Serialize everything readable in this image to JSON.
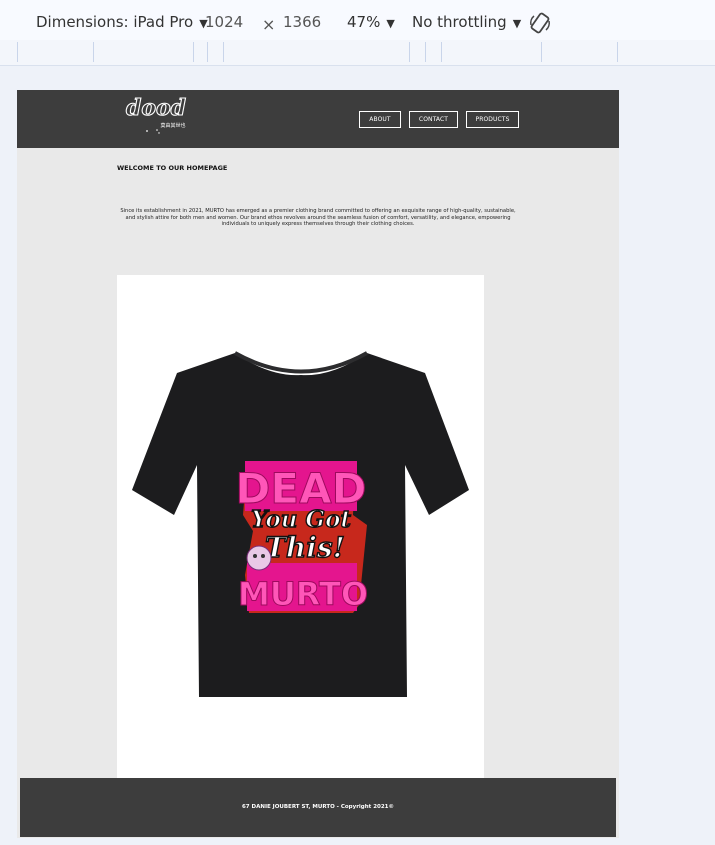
{
  "devtools": {
    "dimensions_label": "Dimensions: iPad Pro",
    "width_value": "1024",
    "times": "×",
    "height_value": "1366",
    "zoom": "47%",
    "throttling": "No throttling"
  },
  "site": {
    "logo_text": "dood",
    "logo_subtext": "莫由其世也",
    "nav": [
      "ABOUT",
      "CONTACT",
      "PRODUCTS"
    ],
    "welcome_heading": "WELCOME TO OUR HOMEPAGE",
    "intro_text": "Since its establishment in 2021, MURTO has emerged as a premier clothing brand committed to offering an exquisite range of high-quality, sustainable, and stylish attire for both men and women. Our brand ethos revolves around the seamless fusion of comfort, versatility, and elegance, empowering individuals to uniquely express themselves through their clothing choices.",
    "product": {
      "print_top": "DEAD",
      "print_line1": "You Got",
      "print_line2": "This!",
      "print_bottom": "MURTO"
    },
    "footer_text": "67 DANIE JOUBERT ST, MURTO - Copyright 2021©"
  },
  "colors": {
    "header_bg": "#3d3d3d",
    "page_bg": "#e9e9e9",
    "shirt": "#1c1c1e",
    "print_pink": "#e4158e",
    "print_red": "#e52a1c"
  }
}
